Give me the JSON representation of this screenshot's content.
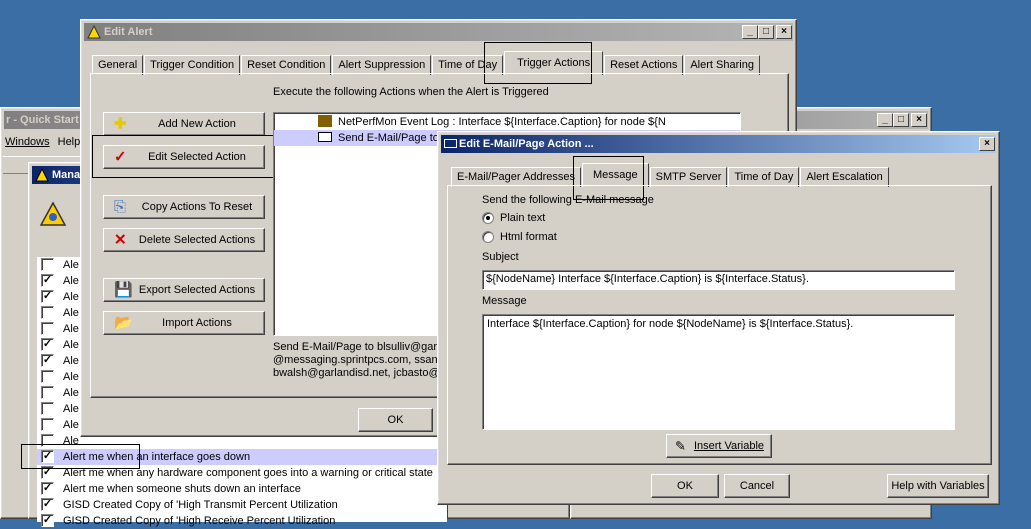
{
  "colors": {
    "desktop": "#3a6ea5",
    "selection": "#ccccff",
    "title_active": "#0a246a"
  },
  "quickstart": {
    "title": "r - Quick Start",
    "menu": [
      "Windows",
      "Help"
    ]
  },
  "manage": {
    "title": "Mana",
    "rows": [
      {
        "checked": false,
        "label": "Ale"
      },
      {
        "checked": true,
        "label": "Ale"
      },
      {
        "checked": true,
        "label": "Ale"
      },
      {
        "checked": false,
        "label": "Ale"
      },
      {
        "checked": false,
        "label": "Ale"
      },
      {
        "checked": true,
        "label": "Ale"
      },
      {
        "checked": true,
        "label": "Ale"
      },
      {
        "checked": false,
        "label": "Ale"
      },
      {
        "checked": false,
        "label": "Ale"
      },
      {
        "checked": false,
        "label": "Ale"
      },
      {
        "checked": false,
        "label": "Ale"
      },
      {
        "checked": false,
        "label": "Ale"
      },
      {
        "checked": true,
        "label": "Alert me when an interface goes down"
      },
      {
        "checked": true,
        "label": "Alert me when any hardware component goes into a warning or critical state"
      },
      {
        "checked": true,
        "label": "Alert me when someone shuts down an interface"
      },
      {
        "checked": true,
        "label": "GISD Created Copy of  'High Transmit Percent Utilization"
      },
      {
        "checked": true,
        "label": "GISD Created Copy of 'High Receive Percent Utilization"
      }
    ]
  },
  "edit_alert": {
    "title": "Edit Alert",
    "tabs": [
      "General",
      "Trigger Condition",
      "Reset Condition",
      "Alert Suppression",
      "Time of Day",
      "Trigger Actions",
      "Reset Actions",
      "Alert Sharing"
    ],
    "instruction": "Execute the following Actions when the Alert is Triggered",
    "buttons": {
      "add": "Add New Action",
      "edit": "Edit Selected Action",
      "copy": "Copy Actions To Reset",
      "delete": "Delete Selected Actions",
      "export": "Export Selected Actions",
      "import": "Import Actions"
    },
    "actions": [
      "NetPerfMon Event Log : Interface ${Interface.Caption} for node ${N",
      "Send E-Mail/Page to"
    ],
    "detail_lines": [
      "Send E-Mail/Page to blsulliv@garla",
      "@messaging.sprintpcs.com, ssand",
      "bwalsh@garlandisd.net, jcbasto@g"
    ],
    "ok": "OK"
  },
  "email_dialog": {
    "title": "Edit E-Mail/Page Action ...",
    "tabs": [
      "E-Mail/Pager Addresses",
      "Message",
      "SMTP Server",
      "Time of Day",
      "Alert Escalation"
    ],
    "send_label": "Send the following E-Mail message",
    "format_options": [
      {
        "label": "Plain text",
        "selected": true
      },
      {
        "label": "Html format",
        "selected": false
      }
    ],
    "subject_label": "Subject",
    "subject_value": "${NodeName} Interface ${Interface.Caption} is ${Interface.Status}.",
    "message_label": "Message",
    "message_value": "Interface ${Interface.Caption} for node ${NodeName} is ${Interface.Status}.",
    "insert_variable": "Insert Variable",
    "ok": "OK",
    "cancel": "Cancel",
    "help": "Help with Variables"
  }
}
